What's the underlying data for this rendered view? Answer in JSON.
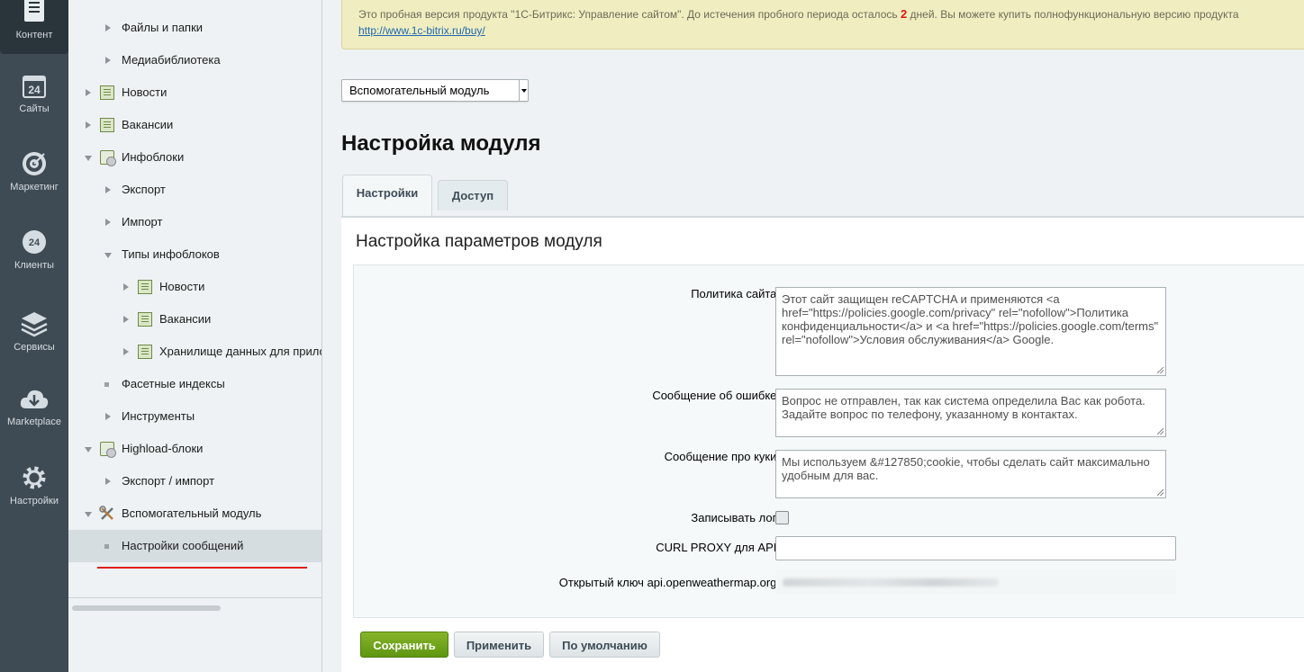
{
  "iconbar": {
    "items": [
      {
        "label": "Контент",
        "icon": "content-icon",
        "active": true
      },
      {
        "label": "Сайты",
        "icon": "sites-calendar-icon"
      },
      {
        "label": "Маркетинг",
        "icon": "target-icon"
      },
      {
        "label": "Клиенты",
        "icon": "clients-24-icon"
      },
      {
        "label": "Сервисы",
        "icon": "layers-icon"
      },
      {
        "label": "Marketplace",
        "icon": "cloud-download-icon"
      },
      {
        "label": "Настройки",
        "icon": "gear-icon"
      }
    ]
  },
  "tree": {
    "items": [
      {
        "label": "Файлы и папки"
      },
      {
        "label": "Медиабиблиотека"
      },
      {
        "label": "Новости"
      },
      {
        "label": "Вакансии"
      },
      {
        "label": "Инфоблоки"
      },
      {
        "label": "Экспорт"
      },
      {
        "label": "Импорт"
      },
      {
        "label": "Типы инфоблоков"
      },
      {
        "label": "Новости"
      },
      {
        "label": "Вакансии"
      },
      {
        "label": "Хранилище данных для приложений"
      },
      {
        "label": "Фасетные индексы"
      },
      {
        "label": "Инструменты"
      },
      {
        "label": "Highload-блоки"
      },
      {
        "label": "Экспорт / импорт"
      },
      {
        "label": "Вспомогательный модуль"
      },
      {
        "label": "Настройки сообщений"
      }
    ]
  },
  "trial": {
    "text_before": "Это пробная версия продукта \"1С-Битрикс: Управление сайтом\". До истечения пробного периода осталось ",
    "days": "2",
    "text_after": " дней. Вы можете купить полнофункциональную версию продукта",
    "link": "http://www.1c-bitrix.ru/buy/"
  },
  "module_select": {
    "value": "Вспомогательный модуль"
  },
  "page_title": "Настройка модуля",
  "tabs": [
    {
      "label": "Настройки",
      "active": true
    },
    {
      "label": "Доступ",
      "active": false
    }
  ],
  "panel": {
    "heading": "Настройка параметров модуля",
    "fields": {
      "policy": {
        "label": "Политика сайта:",
        "value": "Этот сайт защищен reCAPTCHA и применяются <a href=\"https://policies.google.com/privacy\" rel=\"nofollow\">Политика конфиденциальности</a> и <a href=\"https://policies.google.com/terms\" rel=\"nofollow\">Условия обслуживания</a> Google."
      },
      "error_msg": {
        "label": "Сообщение об ошибке:",
        "value": "Вопрос не отправлен, так как система определила Вас как робота. Задайте вопрос по телефону, указанному в контактах."
      },
      "cookie_msg": {
        "label": "Сообщение про куки:",
        "value": "Мы используем &#127850;cookie, чтобы сделать сайт максимально удобным для вас."
      },
      "write_log": {
        "label": "Записывать лог:",
        "checked": false
      },
      "curl_proxy": {
        "label": "CURL PROXY для API:",
        "value": ""
      },
      "owm_key": {
        "label": "Открытый ключ api.openweathermap.org:"
      }
    }
  },
  "buttons": {
    "save": "Сохранить",
    "apply": "Применить",
    "default": "По умолчанию"
  }
}
